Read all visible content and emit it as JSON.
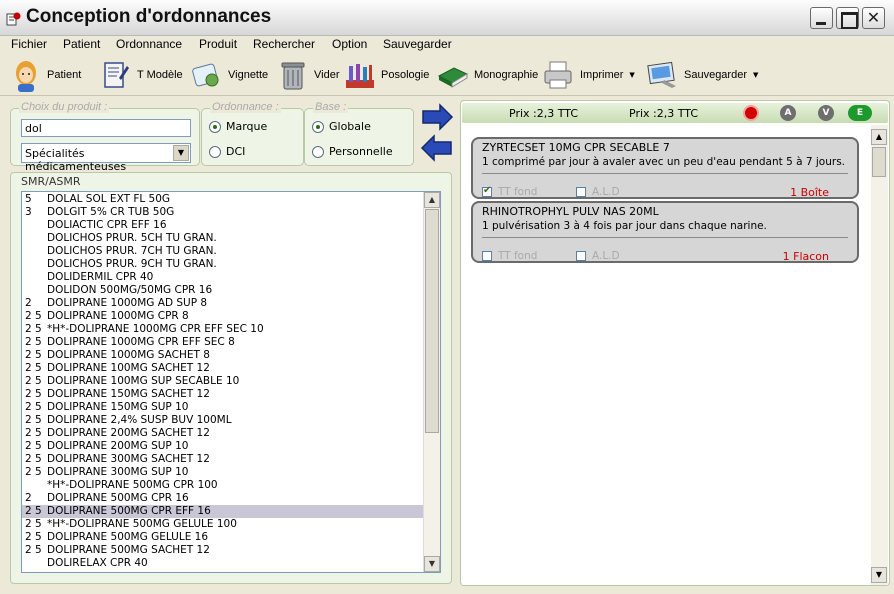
{
  "window": {
    "title": "Conception d'ordonnances"
  },
  "menu": [
    "Fichier",
    "Patient",
    "Ordonnance",
    "Produit",
    "Rechercher",
    "Option",
    "Sauvegarder"
  ],
  "toolbar": {
    "patient": "Patient",
    "modele": "T Modèle",
    "vignette": "Vignette",
    "vider": "Vider",
    "posologie": "Posologie",
    "monographie": "Monographie",
    "imprimer": "Imprimer",
    "sauvegarder": "Sauvegarder"
  },
  "choix": {
    "legend": "Choix du produit :",
    "search_value": "dol",
    "category": "Spécialités médicamenteuses"
  },
  "ordonnance": {
    "legend": "Ordonnance :",
    "opt1": "Marque",
    "opt2": "DCI",
    "selected": "Marque"
  },
  "base": {
    "legend": "Base :",
    "opt1": "Globale",
    "opt2": "Personnelle",
    "selected": "Globale"
  },
  "smr_label": "SMR/ASMR",
  "products": [
    {
      "smr": "5",
      "name": "DOLAL SOL EXT FL 50G"
    },
    {
      "smr": "3",
      "name": "DOLGIT 5% CR TUB 50G"
    },
    {
      "smr": "",
      "name": "DOLIACTIC CPR EFF 16"
    },
    {
      "smr": "",
      "name": "DOLICHOS PRUR. 5CH TU GRAN."
    },
    {
      "smr": "",
      "name": "DOLICHOS PRUR. 7CH TU GRAN."
    },
    {
      "smr": "",
      "name": "DOLICHOS PRUR. 9CH TU GRAN."
    },
    {
      "smr": "",
      "name": "DOLIDERMIL CPR 40"
    },
    {
      "smr": "",
      "name": "DOLIDON 500MG/50MG CPR 16"
    },
    {
      "smr": "2",
      "name": "DOLIPRANE 1000MG AD SUP 8"
    },
    {
      "smr": "2 5",
      "name": "DOLIPRANE 1000MG CPR 8"
    },
    {
      "smr": "2 5",
      "name": "*H*-DOLIPRANE 1000MG CPR EFF SEC 10"
    },
    {
      "smr": "2 5",
      "name": "DOLIPRANE 1000MG CPR EFF SEC 8"
    },
    {
      "smr": "2 5",
      "name": "DOLIPRANE 1000MG SACHET 8"
    },
    {
      "smr": "2 5",
      "name": "DOLIPRANE 100MG SACHET 12"
    },
    {
      "smr": "2 5",
      "name": "DOLIPRANE 100MG SUP SECABLE 10"
    },
    {
      "smr": "2 5",
      "name": "DOLIPRANE 150MG SACHET 12"
    },
    {
      "smr": "2 5",
      "name": "DOLIPRANE 150MG SUP 10"
    },
    {
      "smr": "2 5",
      "name": "DOLIPRANE 2,4% SUSP BUV 100ML"
    },
    {
      "smr": "2 5",
      "name": "DOLIPRANE 200MG SACHET 12"
    },
    {
      "smr": "2 5",
      "name": "DOLIPRANE 200MG SUP 10"
    },
    {
      "smr": "2 5",
      "name": "DOLIPRANE 300MG SACHET 12"
    },
    {
      "smr": "2 5",
      "name": "DOLIPRANE 300MG SUP 10"
    },
    {
      "smr": "",
      "name": "*H*-DOLIPRANE 500MG CPR 100"
    },
    {
      "smr": "2",
      "name": "DOLIPRANE 500MG CPR 16"
    },
    {
      "smr": "2 5",
      "name": "DOLIPRANE 500MG CPR EFF 16",
      "selected": true
    },
    {
      "smr": "2 5",
      "name": "*H*-DOLIPRANE 500MG GELULE 100"
    },
    {
      "smr": "2 5",
      "name": "DOLIPRANE 500MG GELULE 16"
    },
    {
      "smr": "2 5",
      "name": "DOLIPRANE 500MG SACHET 12"
    },
    {
      "smr": "",
      "name": "DOLIRELAX CPR 40"
    }
  ],
  "price": {
    "left": "Prix :2,3 TTC",
    "right": "Prix :2,3 TTC"
  },
  "status_buttons": [
    {
      "label": "",
      "color": "#d00000",
      "name": "stop-icon"
    },
    {
      "label": "A",
      "color": "#6e6e6e",
      "name": "a-badge"
    },
    {
      "label": "V",
      "color": "#6e6e6e",
      "name": "v-badge"
    },
    {
      "label": "E",
      "color": "#1e9a2c",
      "name": "e-badge"
    }
  ],
  "prescriptions": [
    {
      "name": "ZYRTECSET 10MG CPR SECABLE 7",
      "dosage": "1 comprimé par jour à avaler avec un peu d'eau pendant 5 à 7 jours.",
      "tt_fond_label": "TT fond",
      "tt_fond_checked": true,
      "ald_label": "A.L.D",
      "ald_checked": false,
      "qty": "1 Boîte"
    },
    {
      "name": "RHINOTROPHYL PULV NAS 20ML",
      "dosage": "1 pulvérisation 3 à 4 fois par jour dans chaque narine.",
      "tt_fond_label": "TT fond",
      "tt_fond_checked": false,
      "ald_label": "A.L.D",
      "ald_checked": false,
      "qty": "1 Flacon"
    }
  ]
}
